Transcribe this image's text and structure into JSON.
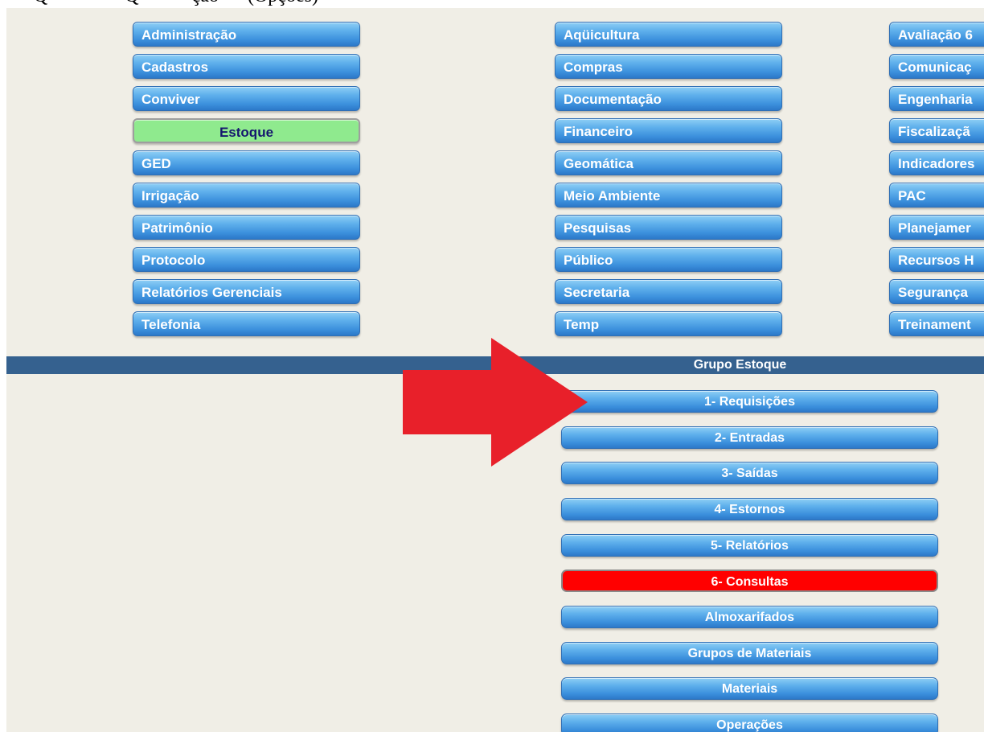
{
  "caption": "— Q — — — Q — — ção — (Opções)",
  "menu": {
    "column1": [
      "Administração",
      "Cadastros",
      "Conviver",
      "Estoque",
      "GED",
      "Irrigação",
      "Patrimônio",
      "Protocolo",
      "Relatórios Gerenciais",
      "Telefonia"
    ],
    "column2": [
      "Aqüicultura",
      "Compras",
      "Documentação",
      "Financeiro",
      "Geomática",
      "Meio Ambiente",
      "Pesquisas",
      "Público",
      "Secretaria",
      "Temp"
    ],
    "column3": [
      "Avaliação 6",
      "Comunicaç",
      "Engenharia",
      "Fiscalizaçã",
      "Indicadores",
      "PAC",
      "Planejamer",
      "Recursos H",
      "Segurança",
      "Treinament"
    ],
    "active": "Estoque"
  },
  "group": {
    "title": "Grupo Estoque",
    "items": [
      "1- Requisições",
      "2- Entradas",
      "3- Saídas",
      "4- Estornos",
      "5- Relatórios",
      "6- Consultas",
      "Almoxarifados",
      "Grupos de Materiais",
      "Materiais",
      "Operações"
    ],
    "highlighted": "6- Consultas"
  },
  "colors": {
    "button_blue": "#3b8fdc",
    "active_green": "#8fea8e",
    "highlight_red": "#ff0000",
    "group_bar": "#35618f",
    "arrow": "#e8202a",
    "background": "#f0eee6"
  },
  "icons": {
    "arrow": "red-arrow-right-icon"
  }
}
